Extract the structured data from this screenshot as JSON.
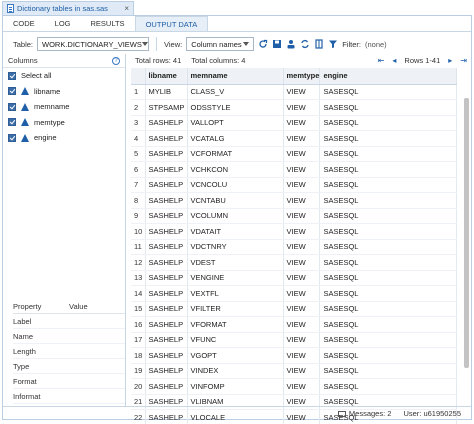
{
  "window": {
    "tab_title": "Dictionary tables in sas.sas"
  },
  "subtabs": [
    "CODE",
    "LOG",
    "RESULTS",
    "OUTPUT DATA"
  ],
  "toolbar": {
    "table_label": "Table:",
    "table_value": "WORK.DICTIONARY_VIEWS",
    "view_label": "View:",
    "view_value": "Column names",
    "filter_label": "Filter:",
    "filter_value": "(none)"
  },
  "columns_panel": {
    "title": "Columns",
    "select_all": "Select all",
    "items": [
      "libname",
      "memname",
      "memtype",
      "engine"
    ]
  },
  "properties": {
    "header_property": "Property",
    "header_value": "Value",
    "rows": [
      "Label",
      "Name",
      "Length",
      "Type",
      "Format",
      "Informat"
    ]
  },
  "grid": {
    "total_rows": "Total rows: 41",
    "total_columns": "Total columns: 4",
    "rows_range": "Rows 1-41",
    "headers": [
      "",
      "libname",
      "memname",
      "memtype",
      "engine"
    ],
    "rows": [
      [
        "1",
        "MYLIB",
        "CLASS_V",
        "VIEW",
        "SASESQL"
      ],
      [
        "2",
        "STPSAMP",
        "ODSSTYLE",
        "VIEW",
        "SASESQL"
      ],
      [
        "3",
        "SASHELP",
        "VALLOPT",
        "VIEW",
        "SASESQL"
      ],
      [
        "4",
        "SASHELP",
        "VCATALG",
        "VIEW",
        "SASESQL"
      ],
      [
        "5",
        "SASHELP",
        "VCFORMAT",
        "VIEW",
        "SASESQL"
      ],
      [
        "6",
        "SASHELP",
        "VCHKCON",
        "VIEW",
        "SASESQL"
      ],
      [
        "7",
        "SASHELP",
        "VCNCOLU",
        "VIEW",
        "SASESQL"
      ],
      [
        "8",
        "SASHELP",
        "VCNTABU",
        "VIEW",
        "SASESQL"
      ],
      [
        "9",
        "SASHELP",
        "VCOLUMN",
        "VIEW",
        "SASESQL"
      ],
      [
        "10",
        "SASHELP",
        "VDATAIT",
        "VIEW",
        "SASESQL"
      ],
      [
        "11",
        "SASHELP",
        "VDCTNRY",
        "VIEW",
        "SASESQL"
      ],
      [
        "12",
        "SASHELP",
        "VDEST",
        "VIEW",
        "SASESQL"
      ],
      [
        "13",
        "SASHELP",
        "VENGINE",
        "VIEW",
        "SASESQL"
      ],
      [
        "14",
        "SASHELP",
        "VEXTFL",
        "VIEW",
        "SASESQL"
      ],
      [
        "15",
        "SASHELP",
        "VFILTER",
        "VIEW",
        "SASESQL"
      ],
      [
        "16",
        "SASHELP",
        "VFORMAT",
        "VIEW",
        "SASESQL"
      ],
      [
        "17",
        "SASHELP",
        "VFUNC",
        "VIEW",
        "SASESQL"
      ],
      [
        "18",
        "SASHELP",
        "VGOPT",
        "VIEW",
        "SASESQL"
      ],
      [
        "19",
        "SASHELP",
        "VINDEX",
        "VIEW",
        "SASESQL"
      ],
      [
        "20",
        "SASHELP",
        "VINFOMP",
        "VIEW",
        "SASESQL"
      ],
      [
        "21",
        "SASHELP",
        "VLIBNAM",
        "VIEW",
        "SASESQL"
      ],
      [
        "22",
        "SASHELP",
        "VLOCALE",
        "VIEW",
        "SASESQL"
      ]
    ]
  },
  "status": {
    "messages": "Messages: 2",
    "user": "User: u61950255"
  }
}
